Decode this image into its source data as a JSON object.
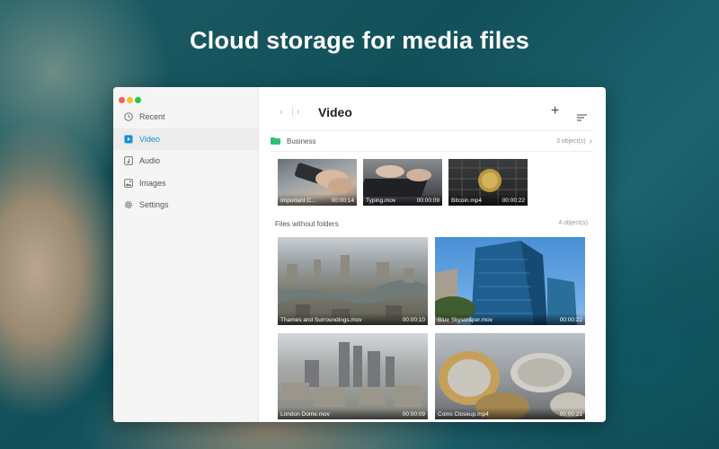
{
  "headline": "Cloud storage for media files",
  "sidebar": {
    "items": [
      {
        "label": "Recent",
        "icon": "clock-icon"
      },
      {
        "label": "Video",
        "icon": "video-icon",
        "active": true
      },
      {
        "label": "Audio",
        "icon": "music-note-icon"
      },
      {
        "label": "Images",
        "icon": "image-icon"
      },
      {
        "label": "Settings",
        "icon": "gear-icon"
      }
    ]
  },
  "toolbar": {
    "title": "Video",
    "back_icon": "chevron-left-icon",
    "forward_icon": "chevron-right-icon",
    "add_icon": "plus-icon",
    "sort_icon": "sort-icon"
  },
  "folder": {
    "name": "Business",
    "count": "3 object(s)",
    "color": "#2fbf71",
    "files": [
      {
        "name": "Important C...",
        "duration": "00:00:14"
      },
      {
        "name": "Typing.mov",
        "duration": "00:00:09"
      },
      {
        "name": "Bitcoin.mp4",
        "duration": "00:00:22"
      }
    ]
  },
  "loose": {
    "label": "Files without folders",
    "count": "4 object(s)",
    "files": [
      {
        "name": "Thames and Surroundings.mov",
        "duration": "00:00:10"
      },
      {
        "name": "Blue Skyscraper.mov",
        "duration": "00:00:22"
      },
      {
        "name": "London Dome.mov",
        "duration": "00:00:09"
      },
      {
        "name": "Coins Closeup.mp4",
        "duration": "00:00:21"
      }
    ]
  },
  "colors": {
    "accent": "#1a8fd6"
  }
}
